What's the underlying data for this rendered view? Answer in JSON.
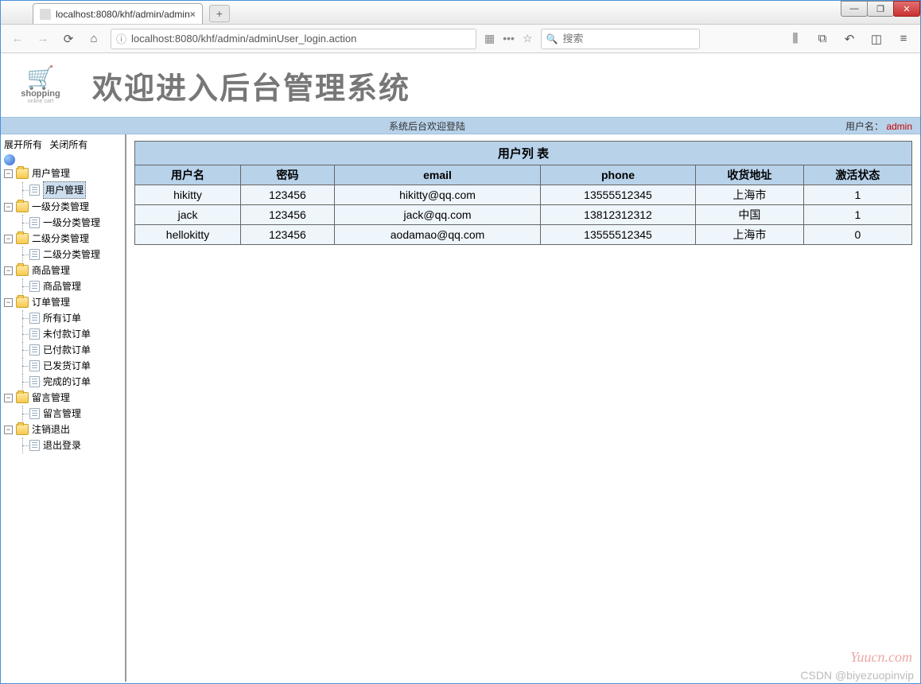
{
  "browser": {
    "tab_title": "localhost:8080/khf/admin/admin",
    "url": "localhost:8080/khf/admin/adminUser_login.action",
    "search_placeholder": "搜索"
  },
  "header": {
    "logo_text": "shopping",
    "logo_sub": "online cart",
    "title": "欢迎进入后台管理系统"
  },
  "status": {
    "center": "系统后台欢迎登陆",
    "user_label": "用户名：",
    "username": "admin"
  },
  "sidebar": {
    "expand_all": "展开所有",
    "collapse_all": "关闭所有",
    "nodes": [
      {
        "label": "用户管理",
        "children": [
          {
            "label": "用户管理",
            "selected": true
          }
        ]
      },
      {
        "label": "一级分类管理",
        "children": [
          {
            "label": "一级分类管理"
          }
        ]
      },
      {
        "label": "二级分类管理",
        "children": [
          {
            "label": "二级分类管理"
          }
        ]
      },
      {
        "label": "商品管理",
        "children": [
          {
            "label": "商品管理"
          }
        ]
      },
      {
        "label": "订单管理",
        "children": [
          {
            "label": "所有订单"
          },
          {
            "label": "未付款订单"
          },
          {
            "label": "已付款订单"
          },
          {
            "label": "已发货订单"
          },
          {
            "label": "完成的订单"
          }
        ]
      },
      {
        "label": "留言管理",
        "children": [
          {
            "label": "留言管理"
          }
        ]
      },
      {
        "label": "注销退出",
        "children": [
          {
            "label": "退出登录"
          }
        ]
      }
    ]
  },
  "table": {
    "title": "用户列 表",
    "columns": [
      "用户名",
      "密码",
      "email",
      "phone",
      "收货地址",
      "激活状态"
    ],
    "rows": [
      [
        "hikitty",
        "123456",
        "hikitty@qq.com",
        "13555512345",
        "上海市",
        "1"
      ],
      [
        "jack",
        "123456",
        "jack@qq.com",
        "13812312312",
        "中国",
        "1"
      ],
      [
        "hellokitty",
        "123456",
        "aodamao@qq.com",
        "13555512345",
        "上海市",
        "0"
      ]
    ]
  },
  "watermark1": "Yuucn.com",
  "watermark2": "CSDN @biyezuopinvip"
}
